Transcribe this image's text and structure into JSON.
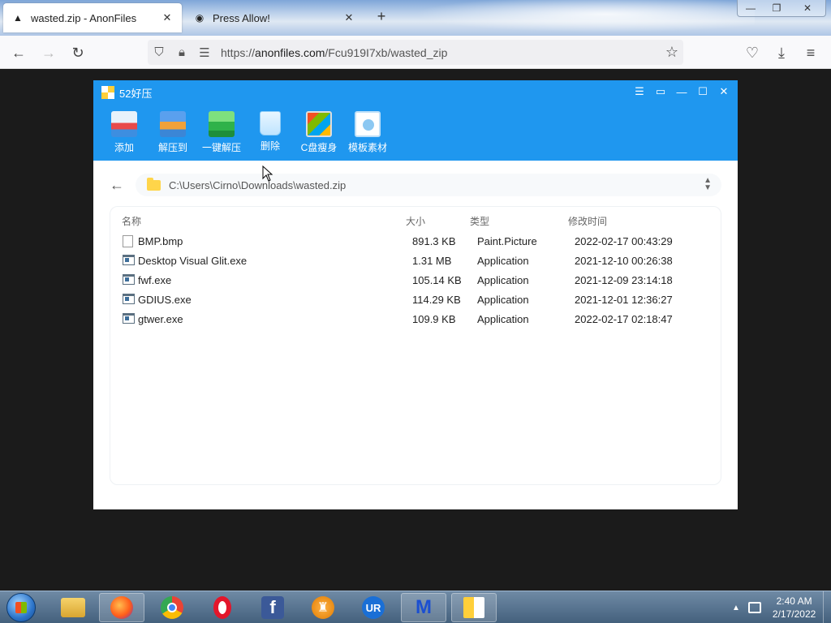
{
  "browser": {
    "tabs": [
      {
        "title": "wasted.zip - AnonFiles",
        "close": "✕"
      },
      {
        "title": "Press Allow!",
        "close": "✕"
      }
    ],
    "new_tab": "+",
    "window_controls": {
      "min": "—",
      "max": "❐",
      "close": "✕"
    },
    "url_prefix": "https://",
    "url_host": "anonfiles.com",
    "url_path": "/Fcu919I7xb/wasted_zip"
  },
  "app": {
    "title": "52好压",
    "toolbar": [
      "添加",
      "解压到",
      "一键解压",
      "删除",
      "C盘瘦身",
      "模板素材"
    ],
    "path": "C:\\Users\\Cirno\\Downloads\\wasted.zip",
    "columns": {
      "name": "名称",
      "size": "大小",
      "type": "类型",
      "modified": "修改时间"
    },
    "files": [
      {
        "name": "BMP.bmp",
        "size": "891.3 KB",
        "type": "Paint.Picture",
        "modified": "2022-02-17 00:43:29",
        "icon": "bmp-file-icon"
      },
      {
        "name": "Desktop Visual Glit.exe",
        "size": "1.31 MB",
        "type": "Application",
        "modified": "2021-12-10 00:26:38",
        "icon": "exe-file-icon"
      },
      {
        "name": "fwf.exe",
        "size": "105.14 KB",
        "type": "Application",
        "modified": "2021-12-09 23:14:18",
        "icon": "exe-file-icon"
      },
      {
        "name": "GDIUS.exe",
        "size": "114.29 KB",
        "type": "Application",
        "modified": "2021-12-01 12:36:27",
        "icon": "exe-file-icon"
      },
      {
        "name": "gtwer.exe",
        "size": "109.9 KB",
        "type": "Application",
        "modified": "2022-02-17 02:18:47",
        "icon": "exe-file-icon"
      }
    ]
  },
  "taskbar": {
    "time": "2:40 AM",
    "date": "2/17/2022",
    "apps": [
      "folder-icon",
      "firefox-icon",
      "chrome-icon",
      "opera-icon",
      "facebook-icon",
      "shield-icon",
      "ur-browser-icon",
      "malwarebytes-icon",
      "52haoya-icon"
    ]
  },
  "colors": {
    "app_blue": "#1f97ef",
    "desktop": "#1b1b1b"
  }
}
